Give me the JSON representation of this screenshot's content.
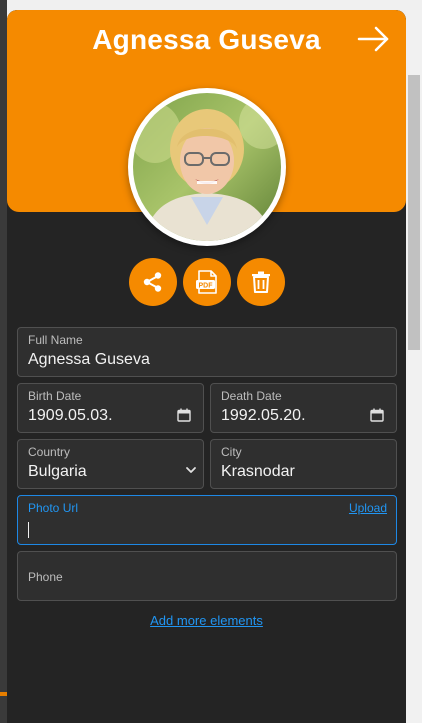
{
  "header": {
    "title": "Agnessa Guseva",
    "accent_color": "#f58a00",
    "next_icon": "arrow-right-icon"
  },
  "avatar": {
    "alt": "Portrait photo"
  },
  "actions": [
    {
      "icon": "share-icon"
    },
    {
      "icon": "pdf-icon",
      "glyph_text": "PDF"
    },
    {
      "icon": "trash-icon"
    }
  ],
  "fields": {
    "full_name": {
      "label": "Full Name",
      "value": "Agnessa Guseva"
    },
    "birth_date": {
      "label": "Birth Date",
      "value": "1909.05.03."
    },
    "death_date": {
      "label": "Death Date",
      "value": "1992.05.20."
    },
    "country": {
      "label": "Country",
      "value": "Bulgaria"
    },
    "city": {
      "label": "City",
      "value": "Krasnodar"
    },
    "photo_url": {
      "label": "Photo Url",
      "value": "",
      "upload_label": "Upload"
    },
    "phone": {
      "label": "Phone",
      "value": ""
    }
  },
  "footer": {
    "add_more_label": "Add more elements"
  }
}
